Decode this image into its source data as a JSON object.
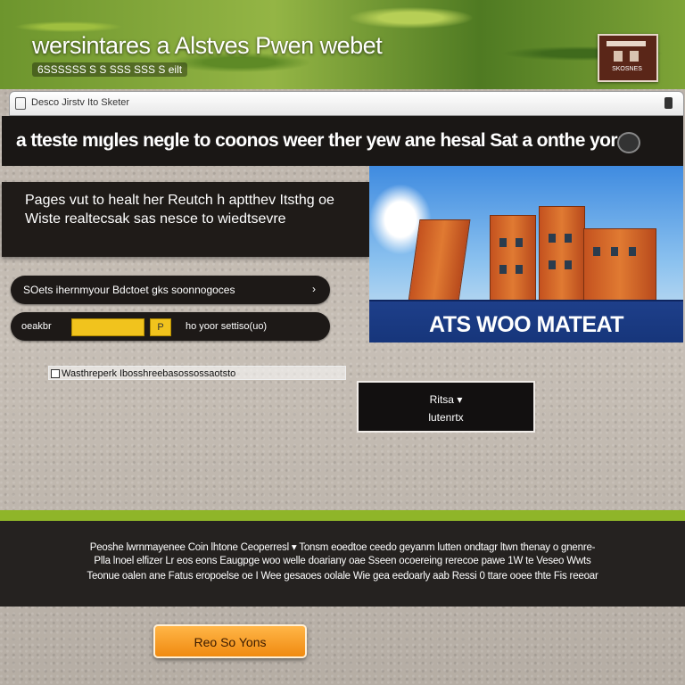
{
  "hero": {
    "title": "wersintares a Alstves Pwen webet",
    "subtitle": "6SSSSSS S S SSS  SSS S eilt",
    "badge_label": "SKOSNES"
  },
  "breadcrumb": {
    "text": "Desco Jirstv  Ito  Sketer"
  },
  "banner": {
    "text": "a ttestе mıgles negle to coonos weer ther yew ane hesal Sat a onthe yor:"
  },
  "info_card": {
    "text": "Pages vut to healt her Reutch h aptthev Itsthg oe Wiste realtecsak sas nesce to wiedtsevre"
  },
  "photo": {
    "caption": "ATS WOO MATEAT"
  },
  "pills": {
    "row1_text": "SOets ihernmyour Bdctoet gks soonnogoces",
    "row1_arrow": "›",
    "row2_label": "oeakbr",
    "row2_field2": "P",
    "row2_text": "ho yoor settiso(uo)"
  },
  "checkline": {
    "text": "Wasthreperk Ibosshreebasossossaotsto"
  },
  "small_button": {
    "line1": "Ritsa ▾",
    "line2": "lutenrtx"
  },
  "footer": {
    "line1": "Peoshe  lwrnmayeneе Coin  lhtone Ceoperresl ▾  Tonsm eoedtoe  ceedo geyanm lutten ondtagr  ltwn thenaу o gnenre-",
    "line2": "Plla lnoel  elfizer Lr eos  eons Eaugpge woo welle  doariany  oae Sseen ocoereing  rerecoe pawe  1W te Veseo  Wwts",
    "line3": "Teonue  oalen ane  Fatus  eropoelse oe  I Wee  gesaoes  oolale  Wie  gea  eedoarly aab  Ressi  0 ttare  ooee thte  Fis reeoar"
  },
  "cta": {
    "label": "Reo So Yons"
  },
  "colors": {
    "accent_green": "#8fb529",
    "cta_orange": "#f08a10",
    "caption_blue": "#1e3f8a",
    "field_yellow": "#f1c31d"
  }
}
